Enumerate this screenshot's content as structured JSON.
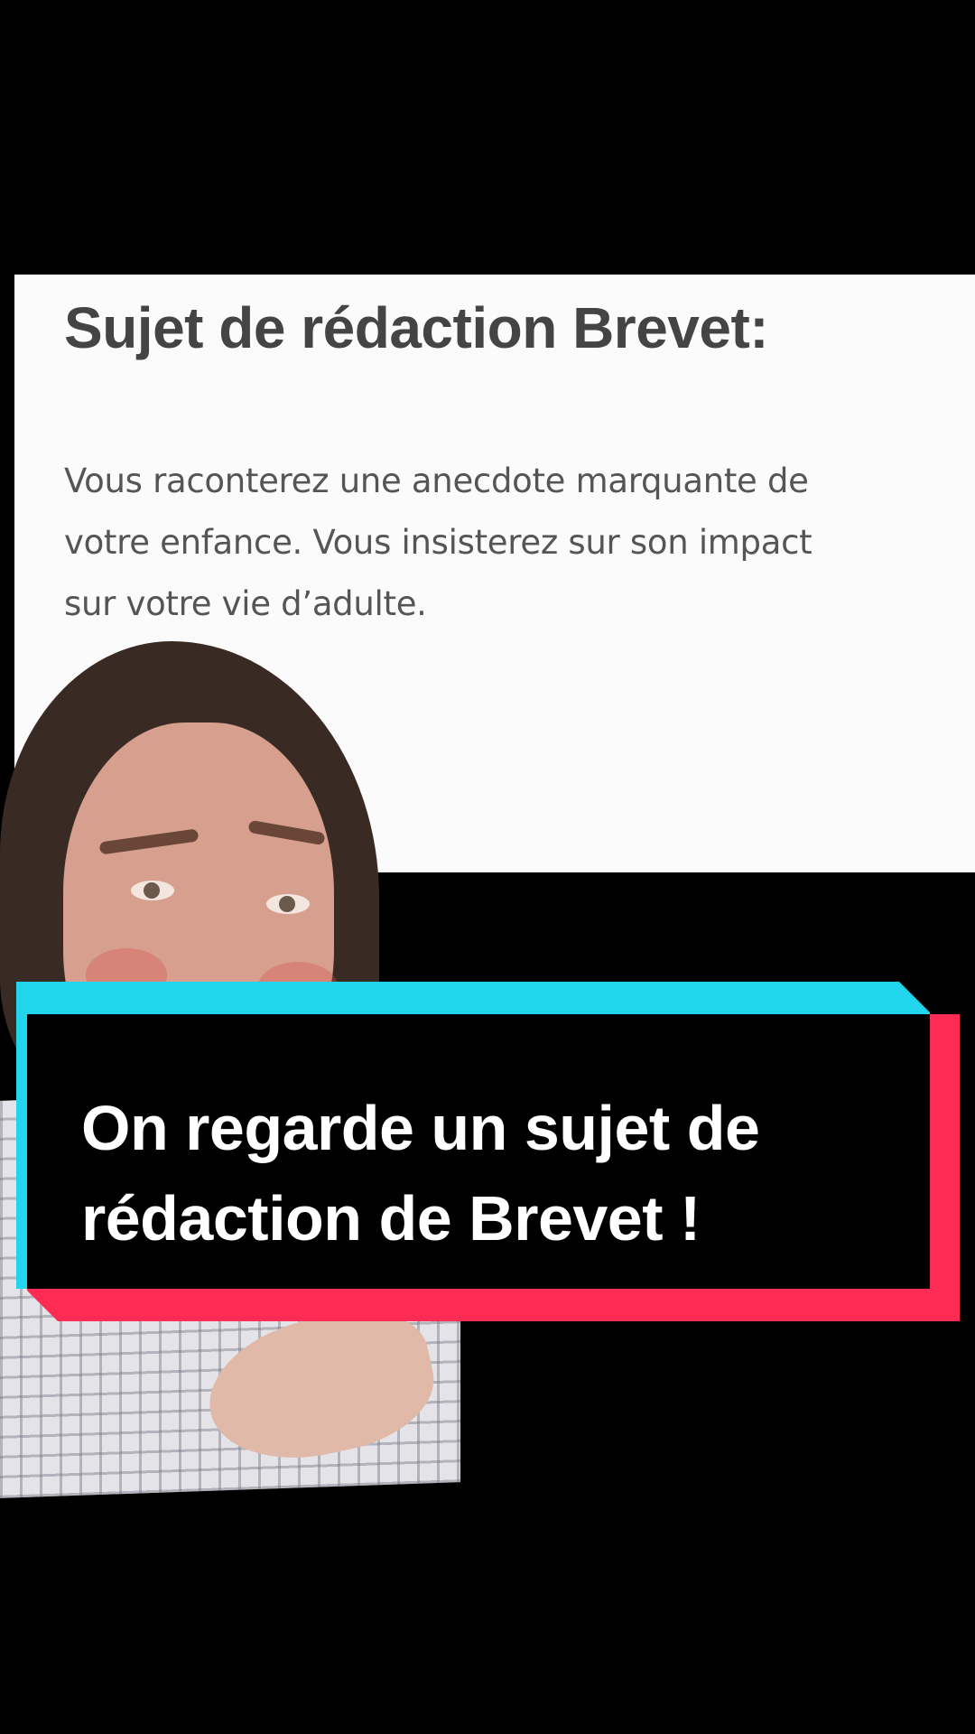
{
  "document": {
    "title": "Sujet de rédaction Brevet:",
    "body_lines": [
      "Vous raconterez une anecdote marquante de",
      "votre enfance. Vous insisterez sur son impact",
      "sur votre vie d’adulte."
    ]
  },
  "caption": {
    "lines": [
      "On regarde un sujet de",
      "rédaction de Brevet !"
    ]
  },
  "colors": {
    "background": "#000000",
    "card": "#fbfbfb",
    "accent_cyan": "#20d5ec",
    "accent_pink": "#fe2c55",
    "caption_text": "#ffffff"
  },
  "icons": {
    "presenter": "presenter-photo"
  }
}
